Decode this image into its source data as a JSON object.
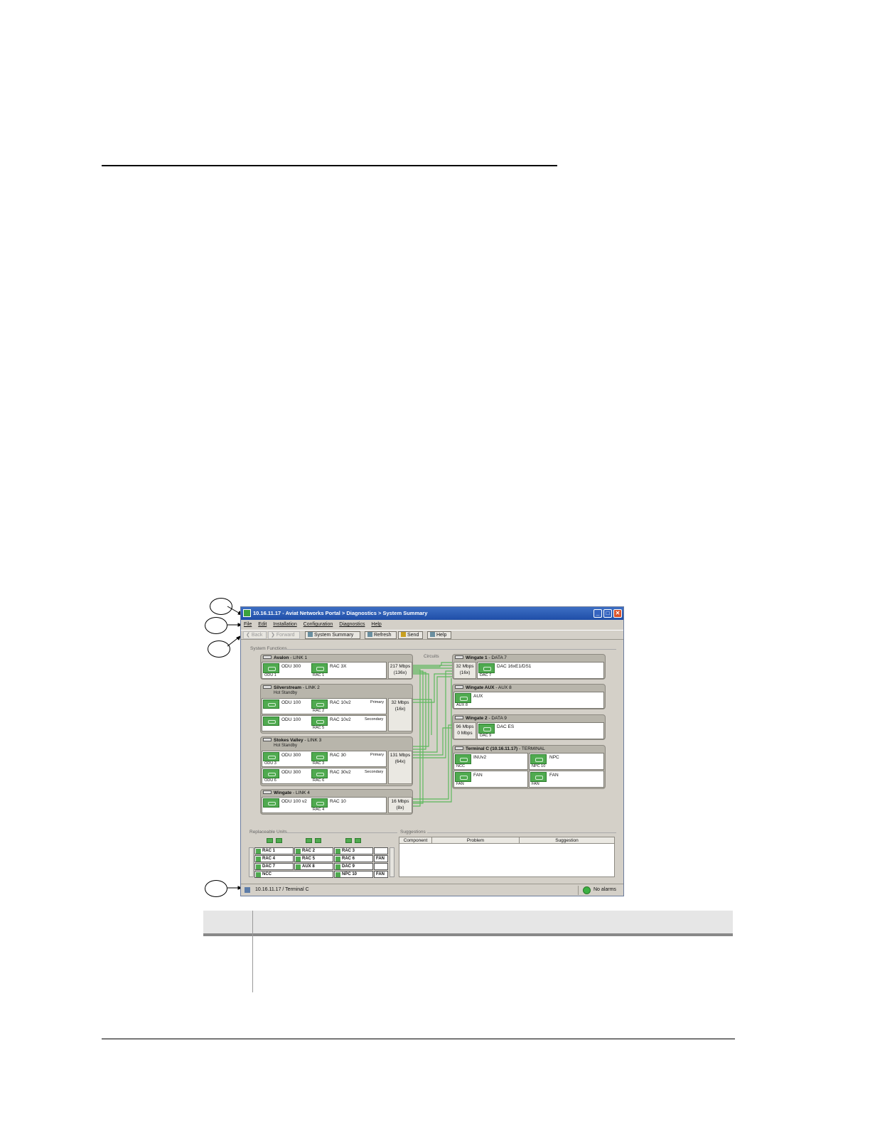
{
  "window": {
    "title": "10.16.11.17  -  Aviat Networks Portal  > Diagnostics  > System Summary",
    "buttons": [
      "_",
      "□",
      "✕"
    ]
  },
  "menu": [
    "File",
    "Edit",
    "Installation",
    "Configuration",
    "Diagnostics",
    "Help"
  ],
  "toolbar": {
    "back": "Back",
    "forward": "Forward",
    "system_summary": "System Summary",
    "refresh": "Refresh",
    "send": "Send",
    "help": "Help"
  },
  "sections": {
    "system_functions": "System Functions",
    "circuits": "Circuits",
    "replaceable_units": "Replaceable Units",
    "suggestions": "Suggestions"
  },
  "links": [
    {
      "name": "Avalon",
      "suffix": " - LINK 1",
      "status": "",
      "rows": [
        {
          "odu": "ODU 300",
          "odu_cap": "ODU 1",
          "rac": "RAC 3X",
          "rac_cap": "RAC 1",
          "role": ""
        }
      ],
      "rate": "217 Mbps",
      "rate_x": "(136x)"
    },
    {
      "name": "Silverstream",
      "suffix": " - LINK 2",
      "status": "Hot Standby",
      "rows": [
        {
          "odu": "ODU 100",
          "odu_cap": "",
          "rac": "RAC 10v2",
          "rac_cap": "RAC 2",
          "role": "Primary"
        },
        {
          "odu": "ODU 100",
          "odu_cap": "",
          "rac": "RAC 10v2",
          "rac_cap": "RAC 5",
          "role": "Secondary"
        }
      ],
      "rate": "32 Mbps",
      "rate_x": "(16x)"
    },
    {
      "name": "Stokes Valley",
      "suffix": " - LINK 3",
      "status": "Hot Standby",
      "rows": [
        {
          "odu": "ODU 300",
          "odu_cap": "ODU 3",
          "rac": "RAC 30",
          "rac_cap": "RAC 3",
          "role": "Primary"
        },
        {
          "odu": "ODU 300",
          "odu_cap": "ODU 6",
          "rac": "RAC 30v2",
          "rac_cap": "RAC 6",
          "role": "Secondary"
        }
      ],
      "rate": "131 Mbps",
      "rate_x": "(64x)"
    },
    {
      "name": "Wingate",
      "suffix": " - LINK 4",
      "status": "",
      "rows": [
        {
          "odu": "ODU 100 v2",
          "odu_cap": "",
          "rac": "RAC 10",
          "rac_cap": "RAC 4",
          "role": ""
        }
      ],
      "rate": "16 Mbps",
      "rate_x": "(8x)"
    }
  ],
  "right_panels": [
    {
      "name": "Wingate 1",
      "suffix": " - DATA 7",
      "rate": "32 Mbps",
      "rate_x": "(16x)",
      "card": "DAC 16xE1/DS1",
      "cap": "DAC 7"
    },
    {
      "name": "Wingate AUX",
      "suffix": " - AUX 8",
      "rate": "",
      "rate_x": "",
      "card": "AUX",
      "cap": "AUX 8"
    },
    {
      "name": "Wingate 2",
      "suffix": " - DATA 9",
      "rate": "96 Mbps",
      "rate_x": "0 Mbps",
      "card": "DAC ES",
      "cap": "DAC 9"
    }
  ],
  "terminal": {
    "name": "Terminal C (10.16.11.17)",
    "suffix": " - TERMINAL",
    "cells": [
      {
        "label": "INUv2",
        "cap": "NCC"
      },
      {
        "label": "NPC",
        "cap": "NPC 10"
      },
      {
        "label": "FAN",
        "cap": "FAN"
      },
      {
        "label": "FAN",
        "cap": "FAN"
      }
    ]
  },
  "replaceable_units": [
    [
      "RAC 1",
      "RAC 2",
      "RAC 3",
      ""
    ],
    [
      "RAC 4",
      "RAC 5",
      "RAC 6",
      "FAN"
    ],
    [
      "DAC 7",
      "AUX 8",
      "DAC 9",
      ""
    ],
    [
      "NCC",
      "",
      "NPC 10",
      "FAN"
    ]
  ],
  "suggestions_table": {
    "columns": [
      "Component",
      "Problem",
      "Suggestion"
    ]
  },
  "status": {
    "address": "10.16.11.17  /  Terminal C",
    "alarms": "No alarms",
    "alarm_color": "#3cb043"
  }
}
